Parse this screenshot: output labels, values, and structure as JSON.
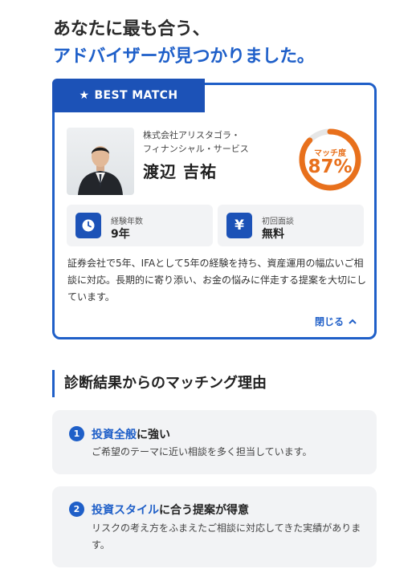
{
  "headline": {
    "line1": "あなたに最も合う、",
    "line2": "アドバイザーが見つかりました。"
  },
  "advisor_card": {
    "badge": "BEST MATCH",
    "company_line1": "株式会社アリスタゴラ・",
    "company_line2": "フィナンシャル・サービス",
    "name": "渡辺 吉祐",
    "match_label": "マッチ度",
    "match_value": "87%",
    "match_percent": 87,
    "stats": [
      {
        "icon": "clock-icon",
        "label": "経験年数",
        "value": "9年"
      },
      {
        "icon": "yen-icon",
        "label": "初回面談",
        "value": "無料"
      }
    ],
    "description": "証券会社で5年、IFAとして5年の経験を持ち、資産運用の幅広いご相談に対応。長期的に寄り添い、お金の悩みに伴走する提案を大切にしています。",
    "close_label": "閉じる"
  },
  "reasons_section": {
    "title": "診断結果からのマッチング理由",
    "items": [
      {
        "number": "1",
        "highlight": "投資全般",
        "rest": "に強い",
        "body": "ご希望のテーマに近い相談を多く担当しています。"
      },
      {
        "number": "2",
        "highlight": "投資スタイル",
        "rest": "に合う提案が得意",
        "body": "リスクの考え方をふまえたご相談に対応してきた実績があります。"
      }
    ]
  },
  "colors": {
    "accent": "#1f5fc8",
    "badge": "#1c52b7",
    "match": "#e8701c"
  }
}
